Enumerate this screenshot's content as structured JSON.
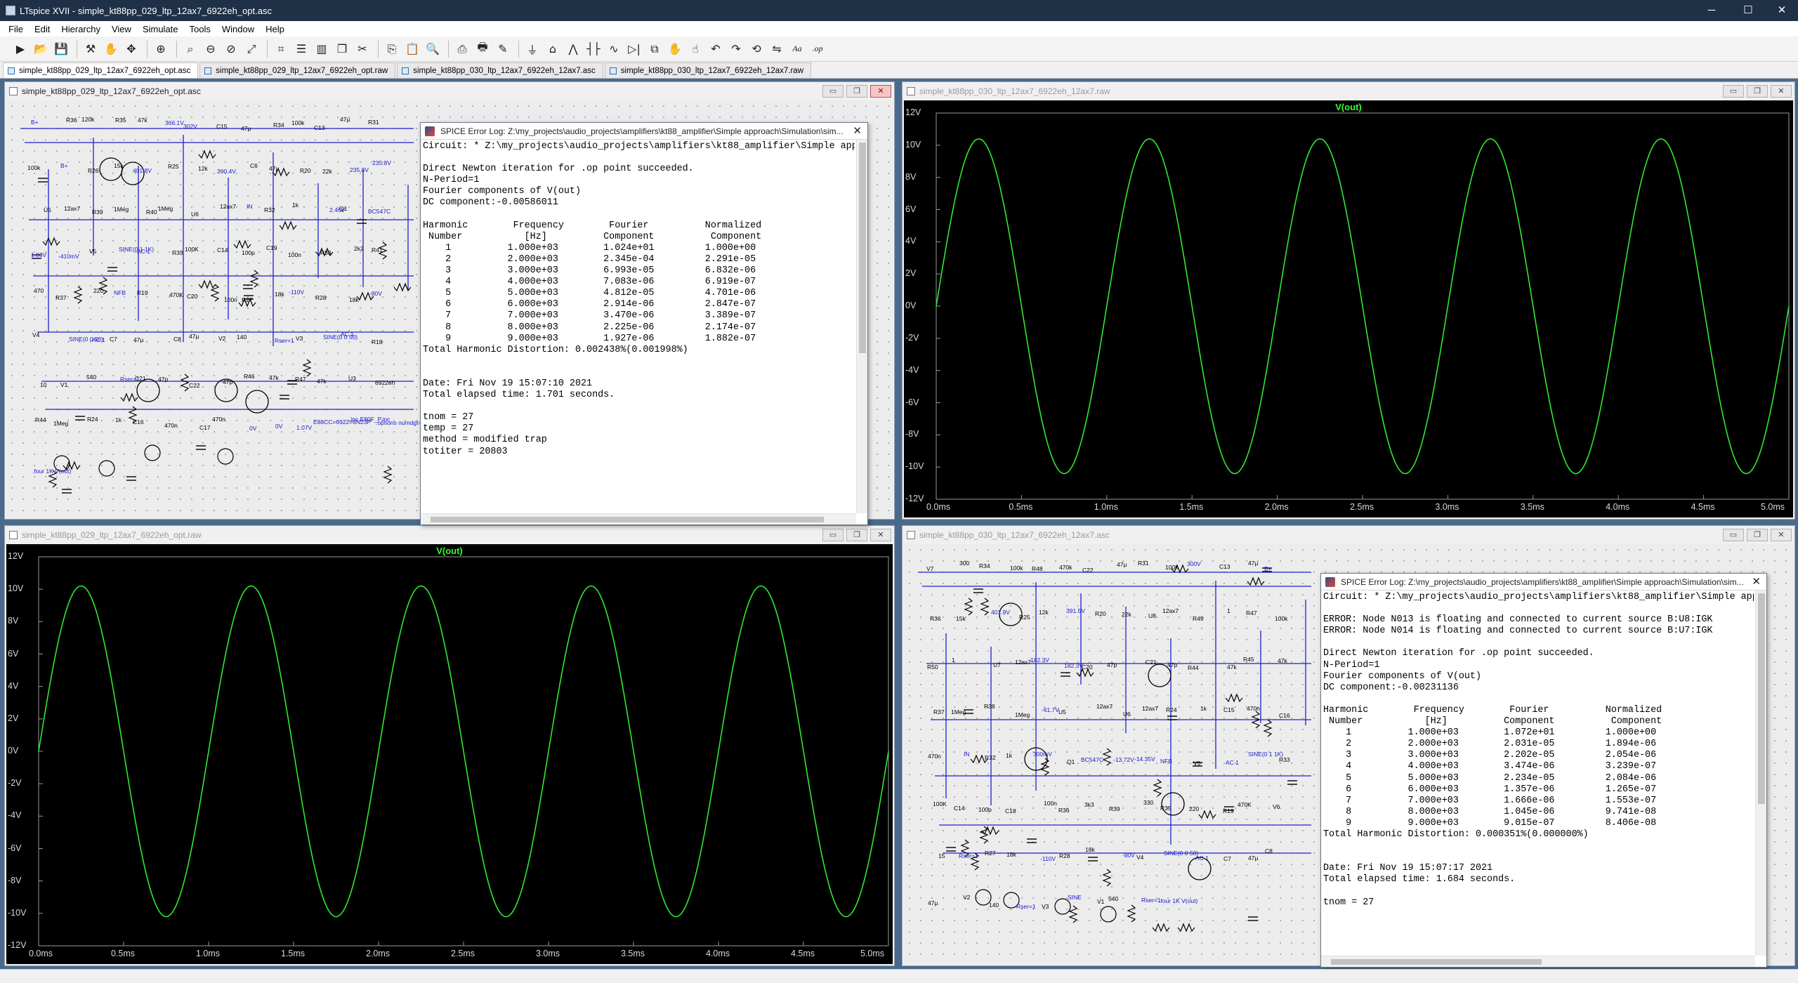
{
  "app": {
    "title": "LTspice XVII - simple_kt88pp_029_ltp_12ax7_6922eh_opt.asc",
    "controls": {
      "minimize": "─",
      "maximize": "☐",
      "close": "✕"
    }
  },
  "menu": [
    "File",
    "Edit",
    "Hierarchy",
    "View",
    "Simulate",
    "Tools",
    "Window",
    "Help"
  ],
  "toolbar": [
    "run-icon",
    "open-icon",
    "save-icon",
    "control-panel-icon",
    "halt-icon",
    "pan-icon",
    "zoom-in-icon",
    "zoom-box-icon",
    "zoom-out-icon",
    "zoom-cancel-icon",
    "autorange-icon",
    "mark-icon",
    "tile-horiz-icon",
    "tile-vert-icon",
    "cascade-icon",
    "cut-icon",
    "copy-icon",
    "paste-icon",
    "find-icon",
    "print-setup-icon",
    "print-icon",
    "wire-icon",
    "ground-icon",
    "label-icon",
    "resistor-icon",
    "capacitor-icon",
    "inductor-icon",
    "diode-icon",
    "component-icon",
    "move-icon",
    "drag-icon",
    "undo-icon",
    "redo-icon",
    "rotate-icon",
    "mirror-icon",
    "text-icon",
    "spice-directive-icon"
  ],
  "tabs": [
    {
      "label": "simple_kt88pp_029_ltp_12ax7_6922eh_opt.asc",
      "active": true
    },
    {
      "label": "simple_kt88pp_029_ltp_12ax7_6922eh_opt.raw",
      "active": false
    },
    {
      "label": "simple_kt88pp_030_ltp_12ax7_6922eh_12ax7.asc",
      "active": false
    },
    {
      "label": "simple_kt88pp_030_ltp_12ax7_6922eh_12ax7.raw",
      "active": false
    }
  ],
  "windows": {
    "schem1": {
      "title": "simple_kt88pp_029_ltp_12ax7_6922eh_opt.asc"
    },
    "plot1": {
      "title": "simple_kt88pp_030_ltp_12ax7_6922eh_12ax7.raw",
      "trace": "V(out)"
    },
    "plot2": {
      "title": "simple_kt88pp_029_ltp_12ax7_6922eh_opt.raw",
      "trace": "V(out)"
    },
    "schem2": {
      "title": "simple_kt88pp_030_ltp_12ax7_6922eh_12ax7.asc"
    }
  },
  "plot_axes": {
    "y_ticks": [
      "12V",
      "10V",
      "8V",
      "6V",
      "4V",
      "2V",
      "0V",
      "-2V",
      "-4V",
      "-6V",
      "-8V",
      "-10V",
      "-12V"
    ],
    "x_ticks": [
      "0.0ms",
      "0.5ms",
      "1.0ms",
      "1.5ms",
      "2.0ms",
      "2.5ms",
      "3.0ms",
      "3.5ms",
      "4.0ms",
      "4.5ms",
      "5.0ms"
    ]
  },
  "chart_data": [
    {
      "type": "line",
      "title": "V(out)",
      "xlabel": "",
      "ylabel": "",
      "xlim": [
        0,
        5.0
      ],
      "ylim": [
        -12,
        12
      ],
      "x_unit": "ms",
      "y_unit": "V",
      "grid": false,
      "series": [
        {
          "name": "V(out)",
          "amplitude": 10.4,
          "frequency_khz": 1.0,
          "offset": -0.006
        }
      ]
    },
    {
      "type": "line",
      "title": "V(out)",
      "xlabel": "",
      "ylabel": "",
      "xlim": [
        0,
        5.0
      ],
      "ylim": [
        -12,
        12
      ],
      "x_unit": "ms",
      "y_unit": "V",
      "grid": false,
      "series": [
        {
          "name": "V(out)",
          "amplitude": 10.2,
          "frequency_khz": 1.0,
          "offset": -0.002
        }
      ]
    }
  ],
  "log1": {
    "title": "SPICE Error Log: Z:\\my_projects\\audio_projects\\amplifiers\\kt88_amplifier\\Simple approach\\Simulation\\sim...",
    "text": "Circuit: * Z:\\my_projects\\audio_projects\\amplifiers\\kt88_amplifier\\Simple approach\n\nDirect Newton iteration for .op point succeeded.\nN-Period=1\nFourier components of V(out)\nDC component:-0.00586011\n\nHarmonic        Frequency        Fourier          Normalized\n Number           [Hz]          Component          Component\n    1          1.000e+03        1.024e+01         1.000e+00\n    2          2.000e+03        2.345e-04         2.291e-05\n    3          3.000e+03        6.993e-05         6.832e-06\n    4          4.000e+03        7.083e-06         6.919e-07\n    5          5.000e+03        4.812e-05         4.701e-06\n    6          6.000e+03        2.914e-06         2.847e-07\n    7          7.000e+03        3.470e-06         3.389e-07\n    8          8.000e+03        2.225e-06         2.174e-07\n    9          9.000e+03        1.927e-06         1.882e-07\nTotal Harmonic Distortion: 0.002438%(0.001998%)\n\n\nDate: Fri Nov 19 15:07:10 2021\nTotal elapsed time: 1.701 seconds.\n\ntnom = 27\ntemp = 27\nmethod = modified trap\ntotiter = 20803"
  },
  "log2": {
    "title": "SPICE Error Log: Z:\\my_projects\\audio_projects\\amplifiers\\kt88_amplifier\\Simple approach\\Simulation\\sim...",
    "text": "Circuit: * Z:\\my_projects\\audio_projects\\amplifiers\\kt88_amplifier\\Simple approach\n\nERROR: Node N013 is floating and connected to current source B:U8:IGK\nERROR: Node N014 is floating and connected to current source B:U7:IGK\n\nDirect Newton iteration for .op point succeeded.\nN-Period=1\nFourier components of V(out)\nDC component:-0.00231136\n\nHarmonic        Frequency        Fourier          Normalized\n Number           [Hz]          Component          Component\n    1          1.000e+03        1.072e+01         1.000e+00\n    2          2.000e+03        2.031e-05         1.894e-06\n    3          3.000e+03        2.202e-05         2.054e-06\n    4          4.000e+03        3.474e-06         3.239e-07\n    5          5.000e+03        2.234e-05         2.084e-06\n    6          6.000e+03        1.357e-06         1.265e-07\n    7          7.000e+03        1.666e-06         1.553e-07\n    8          8.000e+03        1.045e-06         9.741e-08\n    9          9.000e+03        9.015e-07         8.406e-08\nTotal Harmonic Distortion: 0.000351%(0.000000%)\n\n\nDate: Fri Nov 19 15:07:17 2021\nTotal elapsed time: 1.684 seconds.\n\ntnom = 27"
  },
  "schem1_labels": [
    "B+",
    "R36",
    "120k",
    "R35",
    "47k",
    "366.1V",
    "302V",
    "C15",
    "47µ",
    "R34",
    "100k",
    "C13",
    "47µ",
    "R31",
    "100k",
    "B+",
    "R26",
    "15k",
    "401.8V",
    "R25",
    "12k",
    "390.4V",
    "C6",
    "47µ",
    "R20",
    "22k",
    "235.8V",
    "235.8V",
    "U5",
    "12ax7",
    "R39",
    "1Meg",
    "R40",
    "1Meg",
    "U6",
    "12ax7",
    "IN",
    "R32",
    "1k",
    "2.46V",
    "Q1",
    "BC547C",
    "1.03V",
    "-410mV",
    "V5",
    "SINE(0 1 1K)",
    "AC 1",
    "R33",
    "100K",
    "C14",
    "100p",
    "C19",
    "100n",
    "R38",
    "2k2",
    "R41",
    "470",
    "R37",
    "220",
    "NFB",
    "R19",
    "470K",
    "C20",
    "100n",
    "R27",
    "18k",
    "-110V",
    "R28",
    "18k",
    "-80V",
    "V4",
    "SINE(0 0 50)",
    "AC 1",
    "C7",
    "47µ",
    "C8",
    "47µ",
    "V2",
    "140",
    "Rser=1",
    "V3",
    "SINE(0 0 50)",
    "AC 1",
    "R18",
    "10",
    "V1",
    "540",
    "Rser=1",
    "C21",
    "47p",
    "C22",
    "47p",
    "R46",
    "47k",
    "R47",
    "47k",
    "U3",
    "6922eh",
    "R44",
    "1Meg",
    "R24",
    "1k",
    "C16",
    "470n",
    "C17",
    "470n",
    "0V",
    "0V",
    "1.07V",
    "E88CC=6922=6N23P",
    ".inc E80F_P.inc",
    ".options numdgt=7",
    ".four 1K V(out)"
  ],
  "schem2_labels": [
    "V7",
    "300",
    "R34",
    "100k",
    "R48",
    "470k",
    "C22",
    "47µ",
    "R31",
    "100k",
    "300V",
    "C13",
    "47µ",
    "B+",
    "R36",
    "15k",
    "401.9V",
    "R25",
    "12k",
    "391.5V",
    "R20",
    "22k",
    "U8",
    "12ax7",
    "R49",
    "1",
    "R47",
    "100k",
    "R50",
    "1",
    "U7",
    "12ax7",
    "182.3V",
    "182.3V",
    "C20",
    "47p",
    "C21",
    "47p",
    "R44",
    "47k",
    "R45",
    "47k",
    "R37",
    "1Meg",
    "R38",
    "1Meg",
    "-61.7V",
    "U5",
    "12ax7",
    "U6",
    "12ax7",
    "R24",
    "1k",
    "C15",
    "470n",
    "C16",
    "470n",
    "IN",
    "R32",
    "1k",
    "300mV",
    "Q1",
    "BC547C",
    "-13.72V",
    "-14.35V",
    "NFB",
    "V5",
    "AC 1",
    "SINE(0 1 1K)",
    "R33",
    "100K",
    "C14",
    "100p",
    "C18",
    "100n",
    "R36",
    "3k3",
    "R39",
    "330",
    "R35",
    "220",
    "R19",
    "470K",
    "V6",
    "15",
    "Rser=1",
    "R27",
    "18k",
    "-110V",
    "R28",
    "18k",
    "-80V",
    "V4",
    "SINE(0 0 50)",
    "AC 1",
    "C7",
    "47µ",
    "C8",
    "47µ",
    "V2",
    "140",
    "Rser=1",
    "V3",
    "SINE",
    "V1",
    "540",
    "Rser=1",
    ".four 1K V(out)"
  ]
}
